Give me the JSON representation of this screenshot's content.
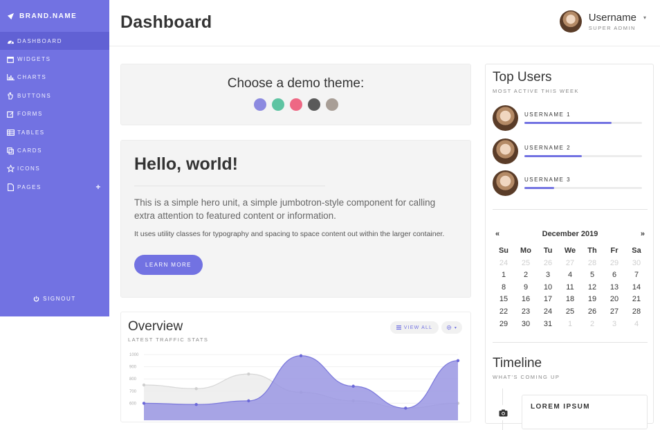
{
  "brand": "BRAND.NAME",
  "sidebar": {
    "items": [
      {
        "label": "DASHBOARD",
        "icon": "dashboard-icon"
      },
      {
        "label": "WIDGETS",
        "icon": "calendar-icon"
      },
      {
        "label": "CHARTS",
        "icon": "bar-chart-icon"
      },
      {
        "label": "BUTTONS",
        "icon": "hand-pointer-icon"
      },
      {
        "label": "FORMS",
        "icon": "edit-icon"
      },
      {
        "label": "TABLES",
        "icon": "table-icon"
      },
      {
        "label": "CARDS",
        "icon": "clone-icon"
      },
      {
        "label": "ICONS",
        "icon": "star-icon"
      },
      {
        "label": "PAGES",
        "icon": "file-icon"
      }
    ],
    "pages_expand": "+",
    "signout": "SIGNOUT"
  },
  "header": {
    "title": "Dashboard",
    "username": "Username",
    "role": "SUPER ADMIN",
    "caret": "▾"
  },
  "theme": {
    "title": "Choose a demo theme:",
    "colors": [
      "#8c8ae0",
      "#5ec4a2",
      "#ee6884",
      "#5a5a5a",
      "#a89e96"
    ]
  },
  "hero": {
    "title": "Hello, world!",
    "lead": "This is a simple hero unit, a simple jumbotron-style component for calling extra attention to featured content or information.",
    "text": "It uses utility classes for typography and spacing to space content out within the larger container.",
    "button": "LEARN MORE"
  },
  "overview": {
    "title": "Overview",
    "subtitle": "LATEST TRAFFIC STATS",
    "view_all": "VIEW ALL"
  },
  "chart_data": {
    "type": "area",
    "y_ticks": [
      "1000",
      "900",
      "800",
      "700",
      "600"
    ],
    "ylim": [
      500,
      1000
    ],
    "series": [
      {
        "values": [
          750,
          720,
          840,
          690,
          620,
          560,
          600
        ]
      },
      {
        "values": [
          600,
          590,
          620,
          990,
          740,
          560,
          950
        ]
      }
    ],
    "colors": [
      "#e9e9e9",
      "#9a97e3"
    ]
  },
  "top_users": {
    "title": "Top Users",
    "subtitle": "MOST ACTIVE THIS WEEK",
    "users": [
      {
        "name": "USERNAME 1",
        "progress": 0.74
      },
      {
        "name": "USERNAME 2",
        "progress": 0.49
      },
      {
        "name": "USERNAME 3",
        "progress": 0.25
      }
    ]
  },
  "calendar": {
    "prev": "«",
    "next": "»",
    "month": "December 2019",
    "dows": [
      "Su",
      "Mo",
      "Tu",
      "We",
      "Th",
      "Fr",
      "Sa"
    ],
    "weeks": [
      [
        "24",
        "25",
        "26",
        "27",
        "28",
        "29",
        "30"
      ],
      [
        "1",
        "2",
        "3",
        "4",
        "5",
        "6",
        "7"
      ],
      [
        "8",
        "9",
        "10",
        "11",
        "12",
        "13",
        "14"
      ],
      [
        "15",
        "16",
        "17",
        "18",
        "19",
        "20",
        "21"
      ],
      [
        "22",
        "23",
        "24",
        "25",
        "26",
        "27",
        "28"
      ],
      [
        "29",
        "30",
        "31",
        "1",
        "2",
        "3",
        "4"
      ]
    ]
  },
  "timeline": {
    "title": "Timeline",
    "subtitle": "WHAT'S COMING UP",
    "items": [
      {
        "title": "LOREM IPSUM",
        "icon": "camera-icon"
      }
    ]
  }
}
